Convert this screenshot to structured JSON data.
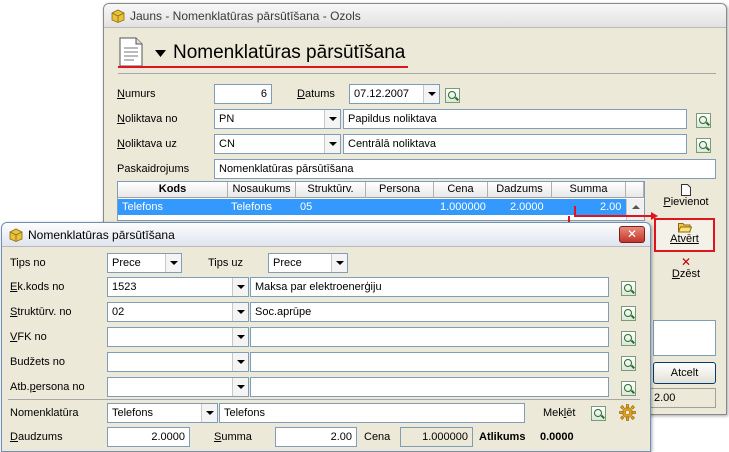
{
  "back_window": {
    "title": "Jauns - Nomenklatūras pārsūtīšana - Ozols",
    "header": "Nomenklatūras pārsūtīšana",
    "numurs_label": "Numurs",
    "numurs_value": "6",
    "datums_label": "Datums",
    "datums_value": "07.12.2007",
    "noliktava_no_label": "Noliktava no",
    "noliktava_no_code": "PN",
    "noliktava_no_name": "Papildus noliktava",
    "noliktava_uz_label": "Noliktava uz",
    "noliktava_uz_code": "CN",
    "noliktava_uz_name": "Centrālā noliktava",
    "paskaidrojums_label": "Paskaidrojums",
    "paskaidrojums_value": "Nomenklatūras pārsūtīšana",
    "grid": {
      "columns": [
        "Kods",
        "Nosaukums",
        "Struktūrv.",
        "Persona",
        "Cena",
        "Dadzums",
        "Summa"
      ],
      "row": {
        "kods": "Telefons",
        "nosaukums": "Telefons",
        "strukturv": "05",
        "persona": "",
        "cena": "1.000000",
        "daudzums": "2.0000",
        "summa": "2.00"
      }
    },
    "buttons": {
      "pievienot": "Pievienot",
      "atvert": "Atvērt",
      "dzest": "Dzēst",
      "atcelt": "Atcelt"
    },
    "footer_value": "2.00"
  },
  "front_window": {
    "title": "Nomenklatūras pārsūtīšana",
    "tips_no_label": "Tips no",
    "tips_no_value": "Prece",
    "tips_uz_label": "Tips uz",
    "tips_uz_value": "Prece",
    "ek_kods_label": "Ek.kods no",
    "ek_kods_code": "1523",
    "ek_kods_name": "Maksa par elektroenerģiju",
    "strukturv_label": "Struktūrv. no",
    "strukturv_code": "02",
    "strukturv_name": "Soc.aprūpe",
    "vfk_label": "VFK no",
    "budzets_label": "Budžets no",
    "atb_persona_label": "Atb.persona no",
    "nomenklatura_label": "Nomenklatūra",
    "nomenklatura_code": "Telefons",
    "nomenklatura_name": "Telefons",
    "meklet_label": "Meklēt",
    "daudzums_label": "Daudzums",
    "daudzums_value": "2.0000",
    "summa_label": "Summa",
    "summa_value": "2.00",
    "cena_label": "Cena",
    "cena_value": "1.000000",
    "atlikums_label": "Atlikums",
    "atlikums_value": "0.0000"
  },
  "colors": {
    "selection": "#3399ff",
    "highlight_red": "#e0141e",
    "window_face": "#ece9d8"
  }
}
